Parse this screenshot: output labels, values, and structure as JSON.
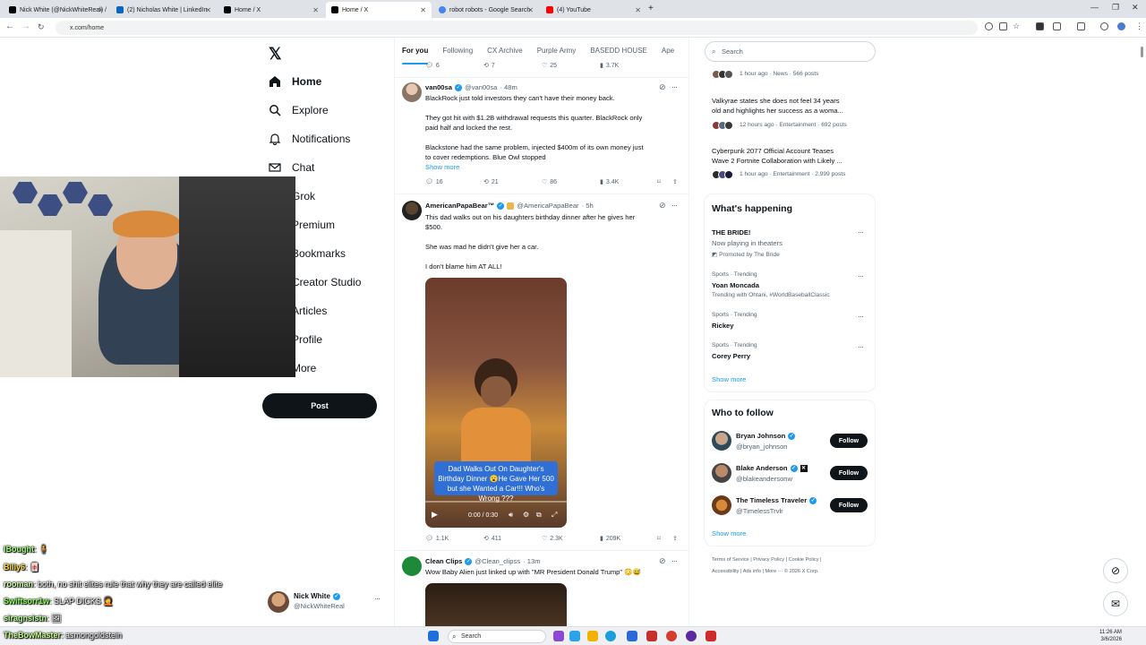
{
  "browser": {
    "tabs": [
      {
        "title": "Nick White (@NickWhiteReal) /",
        "color": "#000000"
      },
      {
        "title": "(2) Nicholas White | LinkedIn",
        "color": "#0a66c2"
      },
      {
        "title": "Home / X",
        "color": "#000000"
      },
      {
        "title": "Home / X",
        "color": "#000000"
      },
      {
        "title": "robot robots - Google Search",
        "color": "#4285f4"
      },
      {
        "title": "(4) YouTube",
        "color": "#ff0000"
      }
    ],
    "url": "x.com/home"
  },
  "nav": {
    "logo": "𝕏",
    "items": [
      {
        "label": "Home",
        "icon": "home-icon"
      },
      {
        "label": "Explore",
        "icon": "search-icon"
      },
      {
        "label": "Notifications",
        "icon": "bell-icon"
      },
      {
        "label": "Chat",
        "icon": "mail-icon"
      },
      {
        "label": "Grok",
        "icon": "grok-icon"
      },
      {
        "label": "Premium",
        "icon": "x-icon"
      },
      {
        "label": "Bookmarks",
        "icon": "bookmark-icon"
      },
      {
        "label": "Creator Studio",
        "icon": "studio-icon"
      },
      {
        "label": "Articles",
        "icon": "article-icon"
      },
      {
        "label": "Profile",
        "icon": "person-icon"
      },
      {
        "label": "More",
        "icon": "more-icon"
      }
    ],
    "post_label": "Post",
    "account": {
      "name": "Nick White",
      "handle": "@NickWhiteReal"
    }
  },
  "feed": {
    "tabs": [
      "For you",
      "Following",
      "CX Archive",
      "Purple Army",
      "BASEDD HOUSE",
      "Ape"
    ],
    "top_stats": {
      "replies": "6",
      "reposts": "7",
      "likes": "25",
      "views": "3.7K"
    },
    "tweets": [
      {
        "name": "van00sa",
        "handle": "@van00sa",
        "time": "· 48m",
        "lines": [
          "BlackRock just told investors they can't have their money back.",
          "They got hit with $1.2B withdrawal requests this quarter. BlackRock only",
          "paid half and locked the rest.",
          "Blackstone had the same problem, injected $400m of its own money just",
          "to cover redemptions. Blue Owl stopped"
        ],
        "show_more": "Show more",
        "stats": {
          "replies": "16",
          "reposts": "21",
          "likes": "86",
          "views": "3.4K"
        }
      },
      {
        "name": "AmericanPapaBear™",
        "handle": "@AmericaPapaBear",
        "time": "· 5h",
        "lines": [
          "This dad walks out on his daughters birthday dinner after he gives her",
          "$500.",
          "She was mad he didn't give her a car.",
          "I don't blame him AT ALL!"
        ],
        "video": {
          "caption": "Dad Walks Out On Daughter's Birthday Dinner 😮He Gave Her 500 but she Wanted a Car!!! Who's Wrong ???",
          "time": "0:00 / 0:30"
        },
        "stats": {
          "replies": "1.1K",
          "reposts": "411",
          "likes": "2.3K",
          "views": "209K"
        }
      },
      {
        "name": "Clean Clips",
        "handle": "@Clean_clipss",
        "time": "· 13m",
        "lines": [
          "Wow Baby Alien just linked up with \"MR President Donald Trump\" 😳😅"
        ]
      }
    ]
  },
  "right": {
    "search_placeholder": "Search",
    "news": [
      {
        "title": "",
        "meta": "1 hour ago · News · 566 posts"
      },
      {
        "title1": "Valkyrae states she does not feel 34 years",
        "title2": "old and highlights her success as a woma...",
        "meta": "12 hours ago · Entertainment · 692 posts"
      },
      {
        "title1": "Cyberpunk 2077 Official Account Teases",
        "title2": "Wave 2 Fortnite Collaboration with Likely ...",
        "meta": "1 hour ago · Entertainment · 2,999 posts"
      }
    ],
    "happening": {
      "title": "What's happening",
      "items": [
        {
          "context": "",
          "title": "THE BRIDE!",
          "sub": "Now playing in theaters",
          "promo": "Promoted by The Bride"
        },
        {
          "context": "Sports · Trending",
          "title": "Yoan Moncada",
          "sub": "Trending with Ohtani, #WorldBaseballClassic"
        },
        {
          "context": "Sports · Trending",
          "title": "Rickey"
        },
        {
          "context": "Sports · Trending",
          "title": "Corey Perry"
        }
      ],
      "show_more": "Show more"
    },
    "who_to_follow": {
      "title": "Who to follow",
      "users": [
        {
          "name": "Bryan Johnson",
          "handle": "@bryan_johnson",
          "button": "Follow"
        },
        {
          "name": "Blake Anderson",
          "handle": "@blakeandersonw",
          "button": "Follow"
        },
        {
          "name": "The Timeless Traveler",
          "handle": "@TimelessTrvlr",
          "button": "Follow"
        }
      ],
      "show_more": "Show more"
    },
    "footer": {
      "line1": [
        "Terms of Service",
        "Privacy Policy",
        "Cookie Policy"
      ],
      "line2": "Accessibility  |  Ads info  |  More ···  © 2026 X Corp."
    }
  },
  "chat": [
    {
      "user": "lBought",
      "msg": ": 🧍"
    },
    {
      "user": "Billy6",
      "msg": ": 🀄"
    },
    {
      "user": "rooman",
      "msg": ": both, no shit elites rule that why they are called elite"
    },
    {
      "user": "Swiftsorr1w",
      "msg": ": SLAP DICKS 🤦"
    },
    {
      "user": "siragnsistn",
      "msg": ": 🖼"
    },
    {
      "user": "TheBowMaster",
      "msg": ": asmongoldstein"
    }
  ],
  "taskbar": {
    "search": "Search",
    "time": "11:26 AM",
    "date": "3/6/2026"
  }
}
